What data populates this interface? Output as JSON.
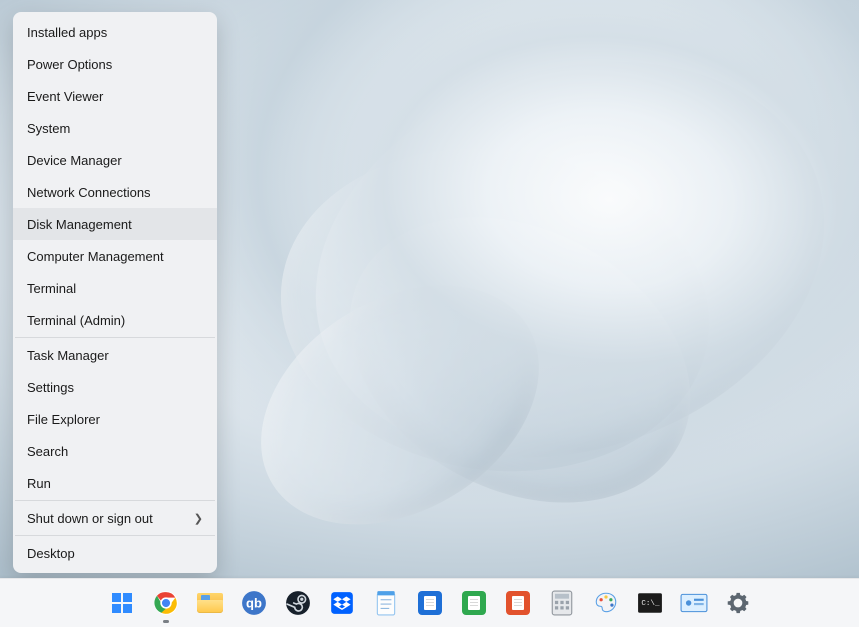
{
  "menu": {
    "items": [
      "Installed apps",
      "Power Options",
      "Event Viewer",
      "System",
      "Device Manager",
      "Network Connections",
      "Disk Management",
      "Computer Management",
      "Terminal",
      "Terminal (Admin)"
    ],
    "group2": [
      "Task Manager",
      "Settings",
      "File Explorer",
      "Search",
      "Run"
    ],
    "group3_label": "Shut down or sign out",
    "group4_label": "Desktop",
    "hovered_index": 6
  },
  "taskbar": {
    "icons": [
      {
        "name": "start",
        "running": false
      },
      {
        "name": "chrome",
        "running": true
      },
      {
        "name": "file-explorer",
        "running": false
      },
      {
        "name": "qbittorrent",
        "running": false
      },
      {
        "name": "steam",
        "running": false
      },
      {
        "name": "dropbox",
        "running": false
      },
      {
        "name": "notepad",
        "running": false
      },
      {
        "name": "libreoffice-writer",
        "running": false
      },
      {
        "name": "libreoffice-calc",
        "running": false
      },
      {
        "name": "libreoffice-impress",
        "running": false
      },
      {
        "name": "calculator",
        "running": false
      },
      {
        "name": "paint",
        "running": false
      },
      {
        "name": "terminal",
        "running": false
      },
      {
        "name": "control-panel",
        "running": false
      },
      {
        "name": "settings",
        "running": false
      }
    ]
  }
}
